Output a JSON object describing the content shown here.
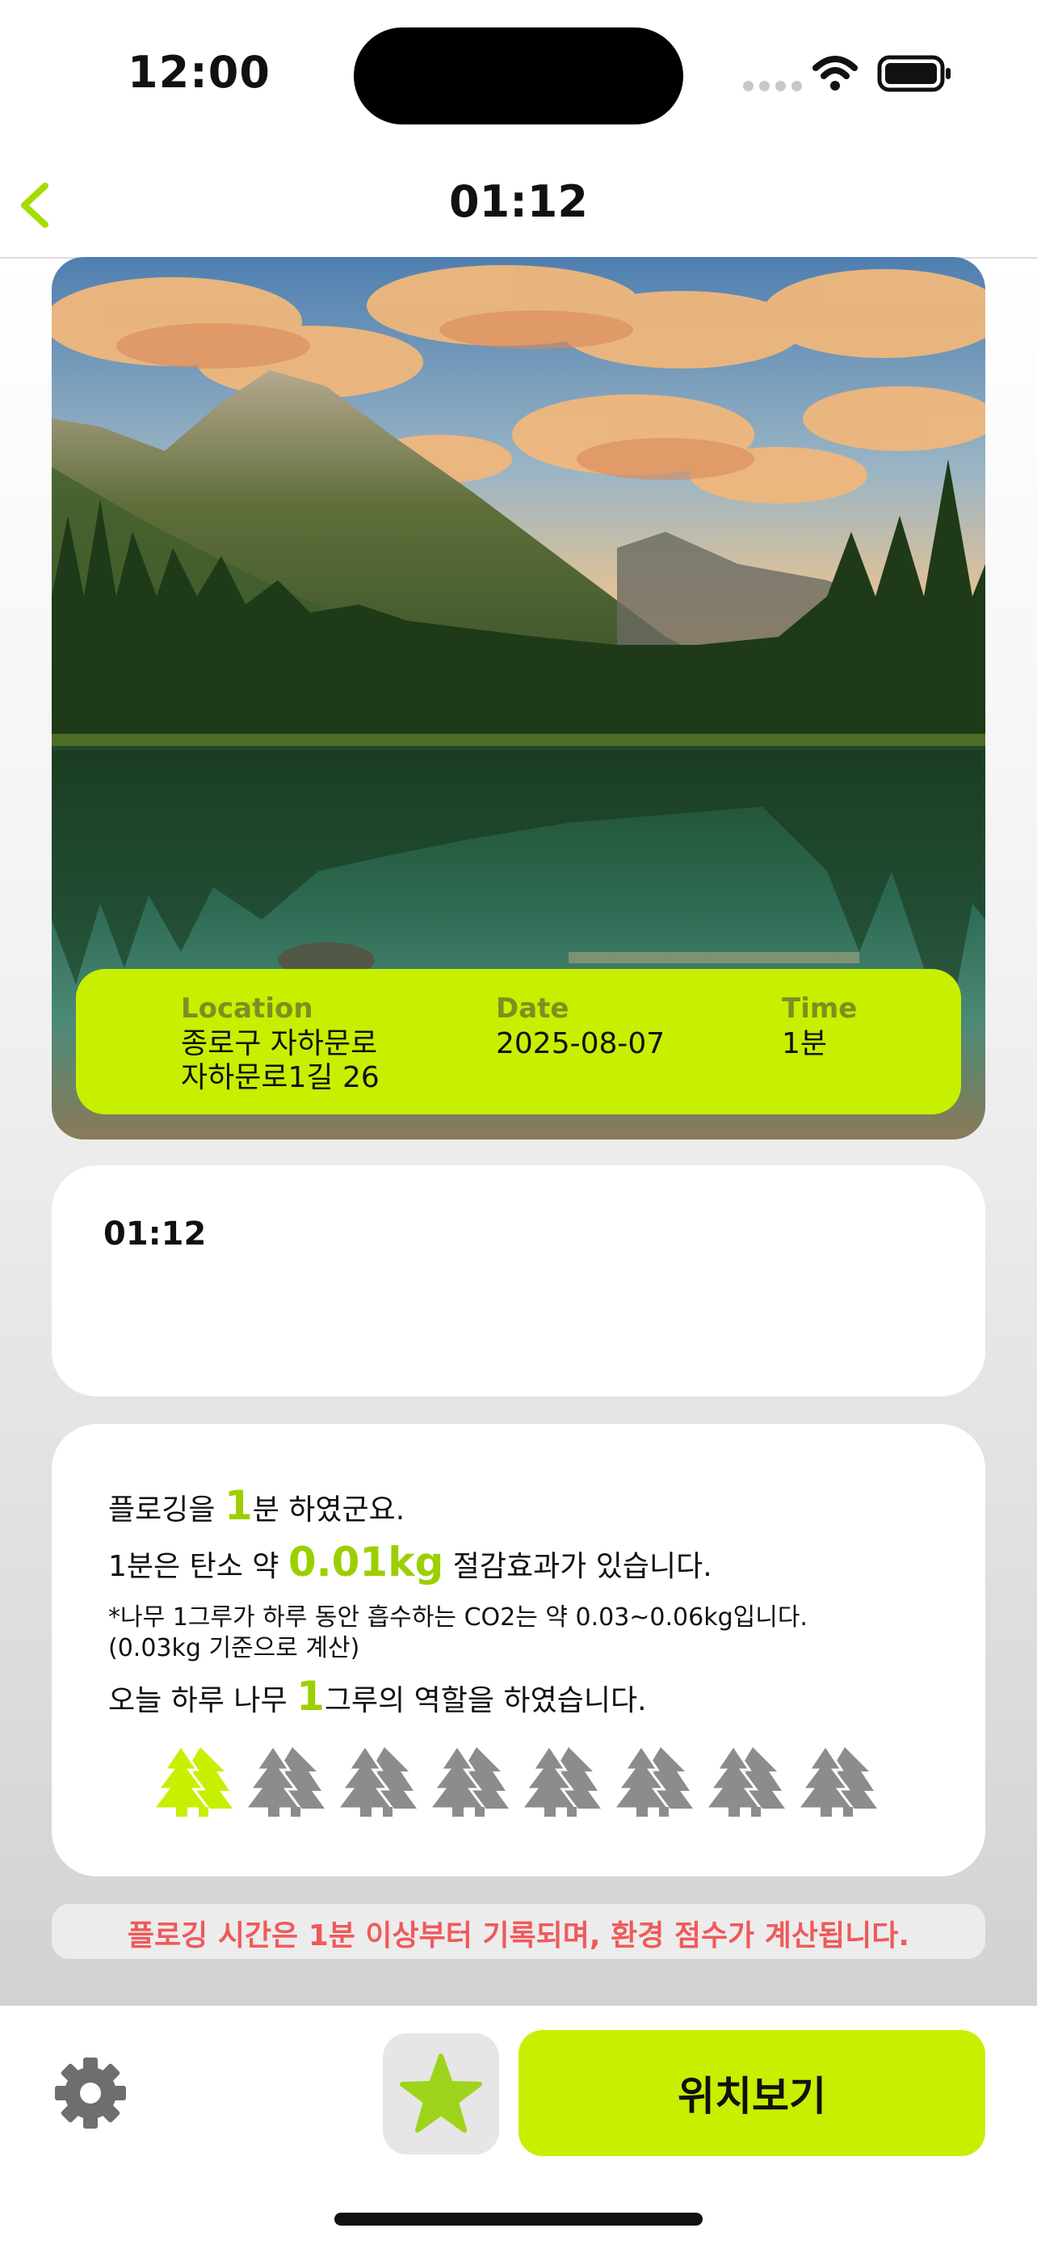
{
  "status_bar": {
    "time": "12:00"
  },
  "nav": {
    "title": "01:12"
  },
  "photo_info": {
    "location_label": "Location",
    "location_line1": "종로구 자하문로",
    "location_line2": "자하문로1길 26",
    "date_label": "Date",
    "date_value": "2025-08-07",
    "time_label": "Time",
    "time_value": "1분"
  },
  "record": {
    "time_text": "01:12"
  },
  "summary": {
    "line1_pre": "플로깅을 ",
    "line1_num": "1",
    "line1_post": "분 하였군요.",
    "line2_pre": "1분은 탄소 약 ",
    "line2_num": "0.01kg",
    "line2_post": " 절감효과가 있습니다.",
    "note1": "*나무 1그루가 하루 동안 흡수하는 CO2는 약 0.03~0.06kg입니다.",
    "note2": "(0.03kg 기준으로 계산)",
    "line3_pre": "오늘 하루 나무 ",
    "line3_num": "1",
    "line3_post": "그루의 역할을 하였습니다.",
    "trees_total": 8,
    "trees_active": 1
  },
  "notice": "플로깅 시간은 1분 이상부터 기록되며, 환경 점수가 계산됩니다.",
  "bottom_bar": {
    "location_button": "위치보기"
  },
  "icons": {
    "back": "chevron-left-icon",
    "settings": "gear-icon",
    "favorite": "star-icon",
    "tree": "tree-icon"
  },
  "colors": {
    "accent": "#c6f000",
    "highlight_text": "#9ccf00",
    "tree_inactive": "#8c8c8c",
    "notice_text": "#ef5a5a"
  }
}
